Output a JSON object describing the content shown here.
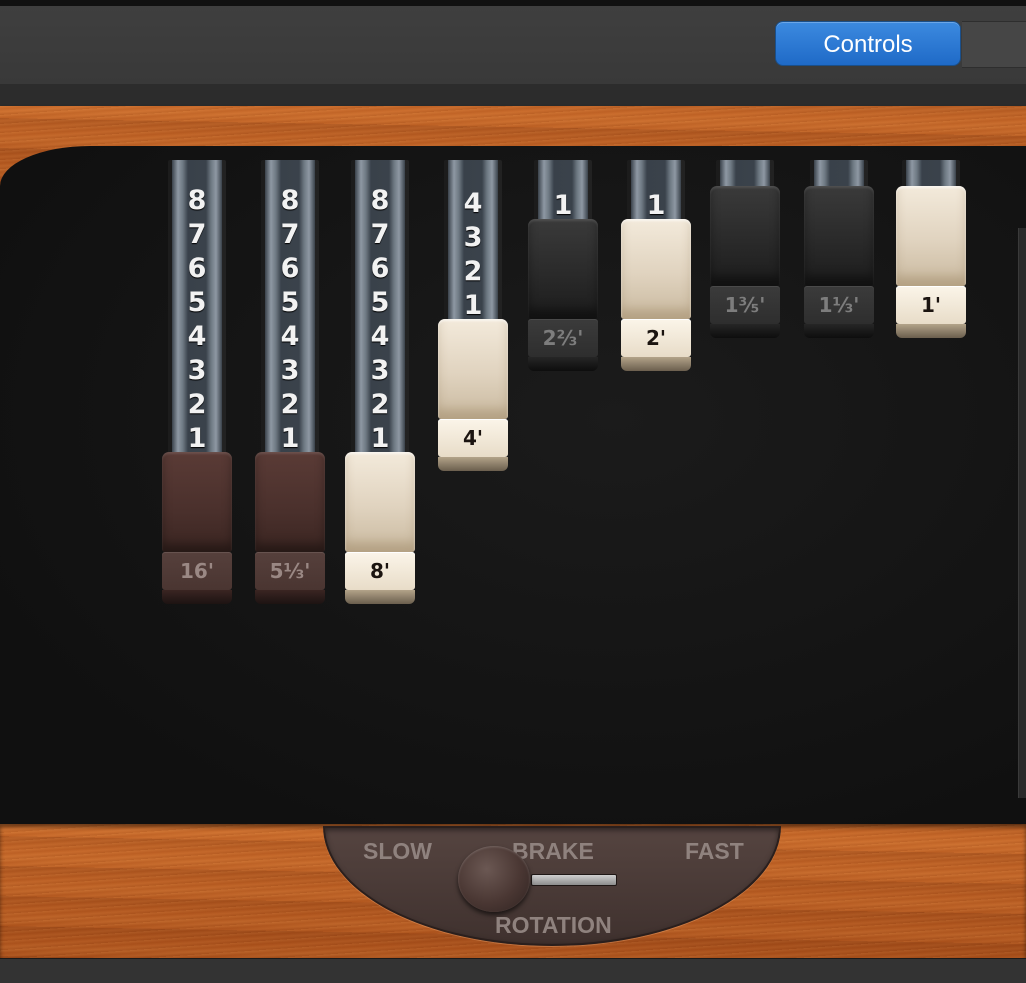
{
  "toolbar": {
    "controls_label": "Controls"
  },
  "drawbars": [
    {
      "label": "16'",
      "level": 8,
      "color": "brown",
      "numbers": [
        "8",
        "7",
        "6",
        "5",
        "4",
        "3",
        "2",
        "1"
      ]
    },
    {
      "label": "5⅓'",
      "level": 8,
      "color": "brown",
      "numbers": [
        "8",
        "7",
        "6",
        "5",
        "4",
        "3",
        "2",
        "1"
      ]
    },
    {
      "label": "8'",
      "level": 8,
      "color": "cream",
      "numbers": [
        "8",
        "7",
        "6",
        "5",
        "4",
        "3",
        "2",
        "1"
      ]
    },
    {
      "label": "4'",
      "level": 4,
      "color": "cream",
      "numbers": [
        "4",
        "3",
        "2",
        "1"
      ]
    },
    {
      "label": "2⅔'",
      "level": 1,
      "color": "black",
      "numbers": [
        "1"
      ]
    },
    {
      "label": "2'",
      "level": 1,
      "color": "cream",
      "numbers": [
        "1"
      ]
    },
    {
      "label": "1⅗'",
      "level": 0,
      "color": "black",
      "numbers": []
    },
    {
      "label": "1⅓'",
      "level": 0,
      "color": "black",
      "numbers": []
    },
    {
      "label": "1'",
      "level": 0,
      "color": "cream",
      "numbers": []
    }
  ],
  "rotation": {
    "slow_label": "SLOW",
    "brake_label": "BRAKE",
    "fast_label": "FAST",
    "title": "ROTATION",
    "setting": "BRAKE"
  }
}
